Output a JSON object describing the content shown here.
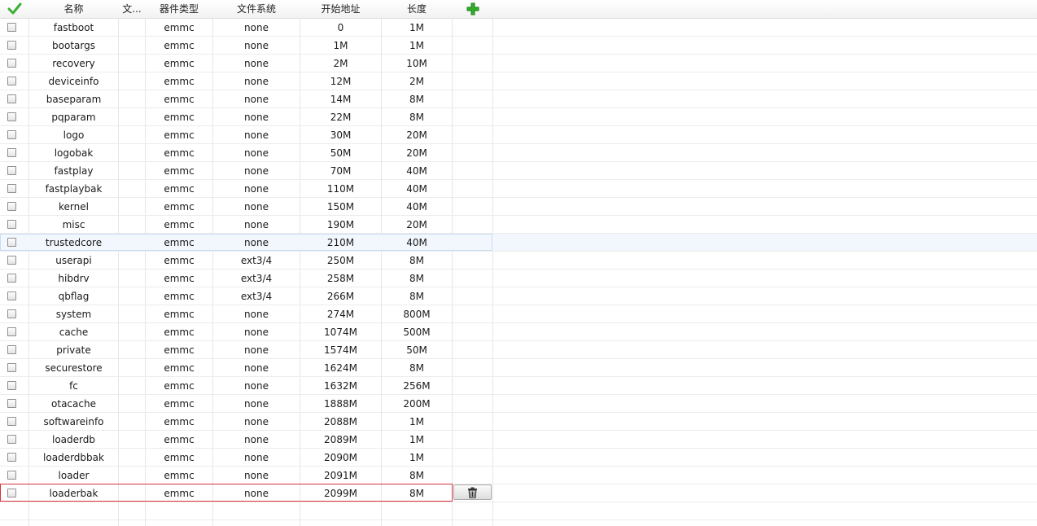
{
  "columns": {
    "name": "名称",
    "file": "文...",
    "device_type": "器件类型",
    "filesystem": "文件系统",
    "start_address": "开始地址",
    "length": "长度"
  },
  "icons": {
    "select_all": "checkmark-icon",
    "add": "add-plus-icon",
    "delete": "trash-icon"
  },
  "colors": {
    "check_green": "#3cb034",
    "add_green": "#2fae2a",
    "selected_border": "#d9343a",
    "hover_bg": "#f2f7fd"
  },
  "rows": [
    {
      "name": "fastboot",
      "file": "",
      "device": "emmc",
      "fs": "none",
      "start": "0",
      "length": "1M"
    },
    {
      "name": "bootargs",
      "file": "",
      "device": "emmc",
      "fs": "none",
      "start": "1M",
      "length": "1M"
    },
    {
      "name": "recovery",
      "file": "",
      "device": "emmc",
      "fs": "none",
      "start": "2M",
      "length": "10M"
    },
    {
      "name": "deviceinfo",
      "file": "",
      "device": "emmc",
      "fs": "none",
      "start": "12M",
      "length": "2M"
    },
    {
      "name": "baseparam",
      "file": "",
      "device": "emmc",
      "fs": "none",
      "start": "14M",
      "length": "8M"
    },
    {
      "name": "pqparam",
      "file": "",
      "device": "emmc",
      "fs": "none",
      "start": "22M",
      "length": "8M"
    },
    {
      "name": "logo",
      "file": "",
      "device": "emmc",
      "fs": "none",
      "start": "30M",
      "length": "20M"
    },
    {
      "name": "logobak",
      "file": "",
      "device": "emmc",
      "fs": "none",
      "start": "50M",
      "length": "20M"
    },
    {
      "name": "fastplay",
      "file": "",
      "device": "emmc",
      "fs": "none",
      "start": "70M",
      "length": "40M"
    },
    {
      "name": "fastplaybak",
      "file": "",
      "device": "emmc",
      "fs": "none",
      "start": "110M",
      "length": "40M"
    },
    {
      "name": "kernel",
      "file": "",
      "device": "emmc",
      "fs": "none",
      "start": "150M",
      "length": "40M"
    },
    {
      "name": "misc",
      "file": "",
      "device": "emmc",
      "fs": "none",
      "start": "190M",
      "length": "20M"
    },
    {
      "name": "trustedcore",
      "file": "",
      "device": "emmc",
      "fs": "none",
      "start": "210M",
      "length": "40M",
      "state": "hover"
    },
    {
      "name": "userapi",
      "file": "",
      "device": "emmc",
      "fs": "ext3/4",
      "start": "250M",
      "length": "8M"
    },
    {
      "name": "hibdrv",
      "file": "",
      "device": "emmc",
      "fs": "ext3/4",
      "start": "258M",
      "length": "8M"
    },
    {
      "name": "qbflag",
      "file": "",
      "device": "emmc",
      "fs": "ext3/4",
      "start": "266M",
      "length": "8M"
    },
    {
      "name": "system",
      "file": "",
      "device": "emmc",
      "fs": "none",
      "start": "274M",
      "length": "800M"
    },
    {
      "name": "cache",
      "file": "",
      "device": "emmc",
      "fs": "none",
      "start": "1074M",
      "length": "500M"
    },
    {
      "name": "private",
      "file": "",
      "device": "emmc",
      "fs": "none",
      "start": "1574M",
      "length": "50M"
    },
    {
      "name": "securestore",
      "file": "",
      "device": "emmc",
      "fs": "none",
      "start": "1624M",
      "length": "8M"
    },
    {
      "name": "fc",
      "file": "",
      "device": "emmc",
      "fs": "none",
      "start": "1632M",
      "length": "256M"
    },
    {
      "name": "otacache",
      "file": "",
      "device": "emmc",
      "fs": "none",
      "start": "1888M",
      "length": "200M"
    },
    {
      "name": "softwareinfo",
      "file": "",
      "device": "emmc",
      "fs": "none",
      "start": "2088M",
      "length": "1M"
    },
    {
      "name": "loaderdb",
      "file": "",
      "device": "emmc",
      "fs": "none",
      "start": "2089M",
      "length": "1M"
    },
    {
      "name": "loaderdbbak",
      "file": "",
      "device": "emmc",
      "fs": "none",
      "start": "2090M",
      "length": "1M"
    },
    {
      "name": "loader",
      "file": "",
      "device": "emmc",
      "fs": "none",
      "start": "2091M",
      "length": "8M"
    },
    {
      "name": "loaderbak",
      "file": "",
      "device": "emmc",
      "fs": "none",
      "start": "2099M",
      "length": "8M",
      "state": "selected"
    }
  ]
}
